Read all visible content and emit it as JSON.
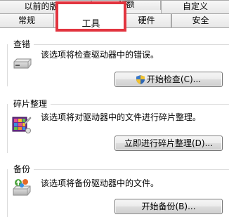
{
  "tabs": {
    "previous_versions": "以前的版本",
    "hidden_partial": "配额",
    "customize": "自定义",
    "general": "常规",
    "tools": "工具",
    "hardware": "硬件",
    "security": "安全"
  },
  "sections": {
    "error_checking": {
      "title": "查错",
      "description": "该选项将检查驱动器中的错误。",
      "button": "开始检查(C)...",
      "icon": "drive-icon"
    },
    "defragmentation": {
      "title": "碎片整理",
      "description": "该选项将对驱动器中的文件进行碎片整理。",
      "button": "立即进行碎片整理(D)...",
      "icon": "defrag-icon"
    },
    "backup": {
      "title": "备份",
      "description": "该选项将备份驱动器中的文件。",
      "button": "开始备份(B)...",
      "icon": "backup-icon"
    }
  },
  "colors": {
    "highlight": "#e2343f"
  }
}
